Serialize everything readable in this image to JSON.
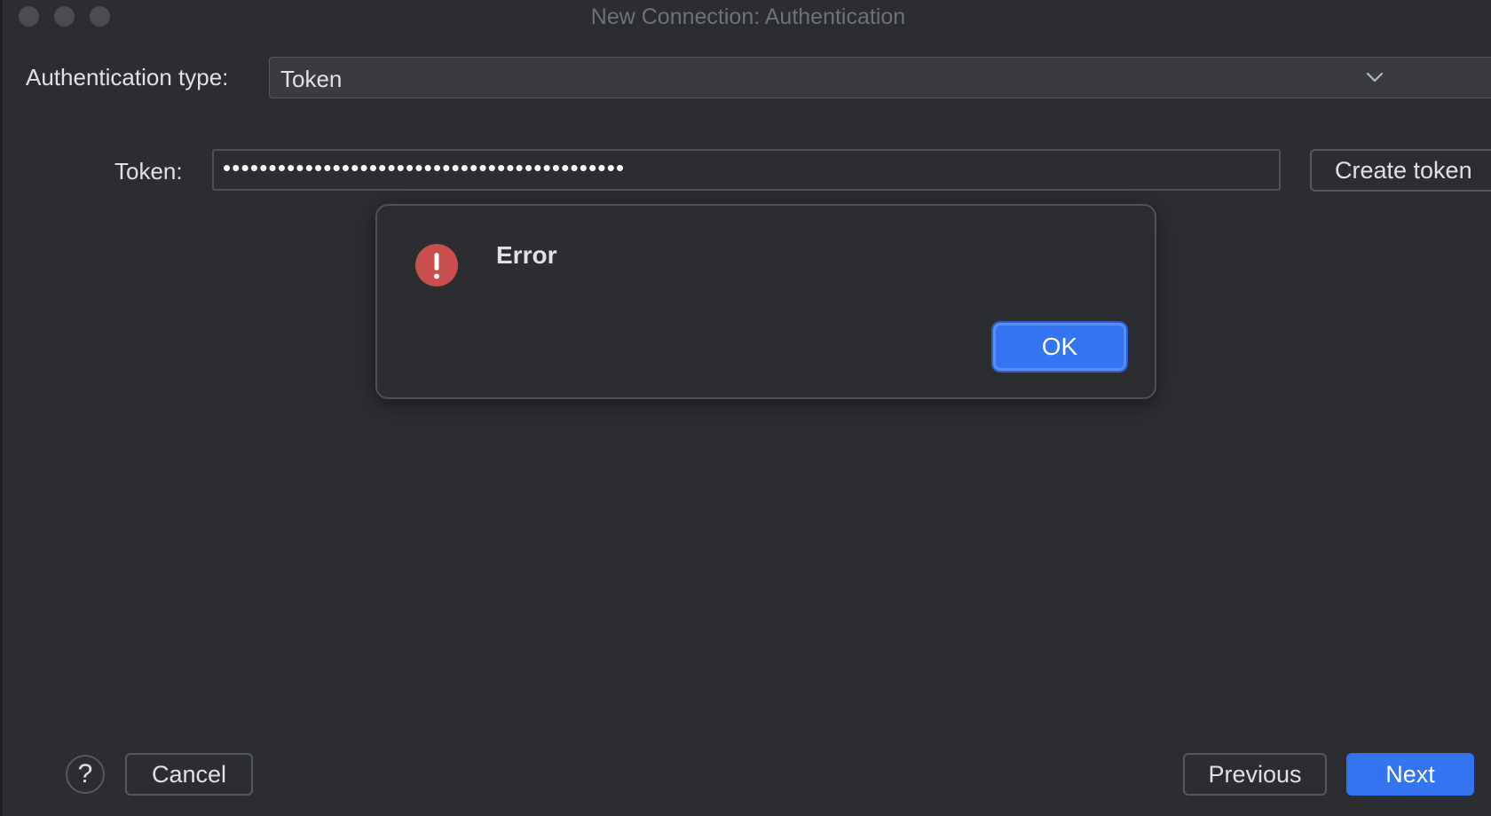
{
  "window": {
    "title": "New Connection: Authentication"
  },
  "form": {
    "auth_type_label": "Authentication type:",
    "auth_type_value": "Token",
    "token_label": "Token:",
    "token_value": "••••••••••••••••••••••••••••••••••••••••••••",
    "create_token_label": "Create token"
  },
  "dialog": {
    "title": "Error",
    "ok_label": "OK",
    "icon": "error-icon",
    "icon_color": "#c94f4f"
  },
  "footer": {
    "help_label": "?",
    "cancel_label": "Cancel",
    "previous_label": "Previous",
    "next_label": "Next"
  },
  "colors": {
    "background": "#2b2d30",
    "accent": "#3574f0"
  }
}
